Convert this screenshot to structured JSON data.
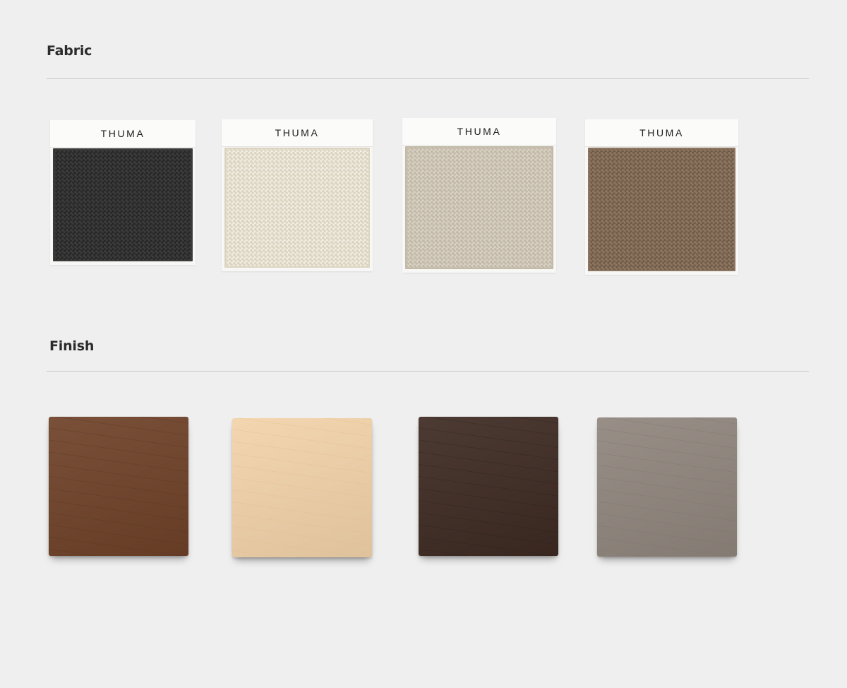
{
  "fabric": {
    "title": "Fabric",
    "swatches": [
      {
        "brand": "THUMA",
        "name": "black-fabric-swatch",
        "color": "#262626",
        "weave": "#3b3b3b"
      },
      {
        "brand": "THUMA",
        "name": "ivory-fabric-swatch",
        "color": "#f1ede3",
        "weave": "#dcd4c0"
      },
      {
        "brand": "THUMA",
        "name": "linen-fabric-swatch",
        "color": "#d9d2c4",
        "weave": "#c2b9a8"
      },
      {
        "brand": "THUMA",
        "name": "brown-fabric-swatch",
        "color": "#6f5a47",
        "weave": "#8c7560"
      }
    ]
  },
  "finish": {
    "title": "Finish",
    "swatches": [
      {
        "name": "walnut-finish-swatch",
        "color": "#6e4128",
        "grain": "#5a331f"
      },
      {
        "name": "natural-finish-swatch",
        "color": "#f2d3aa",
        "grain": "#e2b98a"
      },
      {
        "name": "espresso-finish-swatch",
        "color": "#3d2a22",
        "grain": "#2e1f19"
      },
      {
        "name": "gray-finish-swatch",
        "color": "#8f857d",
        "grain": "#7c736c"
      }
    ]
  }
}
